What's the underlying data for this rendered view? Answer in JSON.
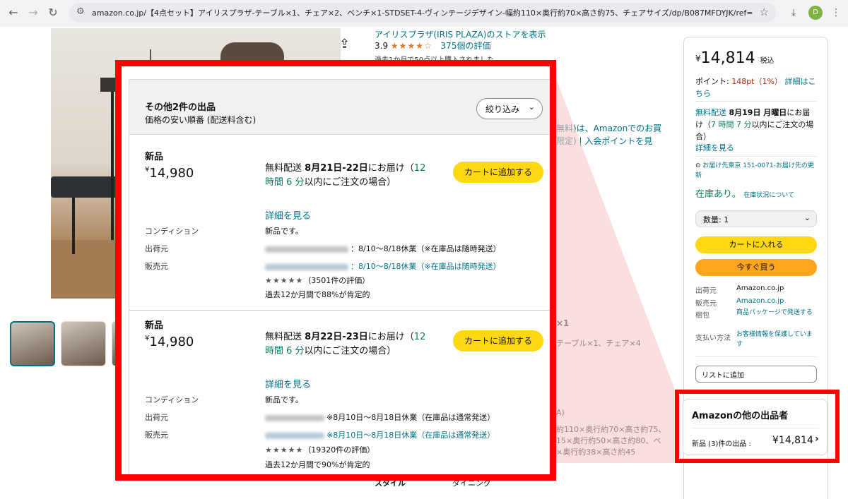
{
  "browser": {
    "url": "amazon.co.jp/【4点セット】アイリスプラザ-テーブル×1、チェア×2、ベンチ×1-STDSET-4-ヴィンテージデザイン-幅約110×奥行約70×高さ約75、チェアサイズ/dp/B087MFDYJK/ref=sr_1_5?__mk_ja_JP=カ...",
    "back_icon": "back-arrow-icon",
    "forward_icon": "forward-arrow-icon",
    "reload_icon": "reload-icon",
    "profile_initial": "D"
  },
  "product": {
    "store_link": "アイリスプラザ(IRIS PLAZA)のストアを表示",
    "rating_value": "3.9",
    "rating_stars": "★★★★☆",
    "rating_count": "375個の評価",
    "purchases": "過去1か月で50点以上購入されました",
    "bg_snippet_1": "無料)は、Amazonでのお買",
    "bg_snippet_2": "限定) | 入会ポイントを見",
    "bg_snippet_3": "×1",
    "bg_snippet_4": "テーブル×1、チェア×4",
    "bg_snippet_5": "A)",
    "bg_snippet_6": "約110×奥行約70×高さ約75、",
    "bg_snippet_7": "15×奥行約50×高さ約80、ベ",
    "bg_snippet_8": "×奥行約38×高さ約45",
    "bottom_left": "スタイル",
    "bottom_right": "ダイニング"
  },
  "buybox": {
    "yen": "¥",
    "price": "14,814",
    "tax": "税込",
    "points_label": "ポイント: ",
    "points_value": "148pt（1%）",
    "points_link": "詳細はこちら",
    "delivery_free": "無料配送",
    "delivery_date": "8月19日 月曜日",
    "delivery_suffix": "にお届け（",
    "delivery_timer": "7 時間 7 分",
    "delivery_tail": "以内にご注文の場合）",
    "delivery_more": "詳細を見る",
    "location_icon": "location-pin-icon",
    "location": "お届け先東京 151-0071-お届け先の更新",
    "stock": "在庫あり。",
    "stock_link": "在庫状況について",
    "qty": "数量: 1",
    "add_cart": "カートに入れる",
    "buy_now": "今すぐ買う",
    "ship_from_k": "出荷元",
    "ship_from_v": "Amazon.co.jp",
    "seller_k": "販売元",
    "seller_v": "Amazon.co.jp",
    "pack_k": "梱包",
    "pack_v": "商品パッケージで発送する",
    "pay_k": "支払い方法",
    "pay_v": "お客様情報を保護しています",
    "wishlist": "リストに追加"
  },
  "other_sellers_box": {
    "title": "Amazonの他の出品者",
    "new_label": "新品 (3)件の出品 :",
    "price": "¥14,814",
    "chevron": "›"
  },
  "panel": {
    "title": "その他2件の出品",
    "subtitle": "価格の安い順番 (配送料含む)",
    "filter_label": "絞り込み",
    "offers": [
      {
        "condition": "新品",
        "yen": "¥",
        "price": "14,980",
        "delivery_free": "無料配送",
        "delivery_date": "8月21日-22日",
        "delivery_suffix": "にお届け（",
        "delivery_timer": "12 時間 6 分",
        "delivery_tail": "以内にご注文の場合）",
        "details": "詳細を見る",
        "add_cart": "カートに追加する",
        "condition_label": "コンディション",
        "condition_value": "新品です。",
        "ship_from_label": "出荷元",
        "ship_from_value": "：8/10～8/18休業（※在庫品は随時発送）",
        "seller_label": "販売元",
        "seller_value": "：8/10～8/18休業（※在庫品は随時発送）",
        "stars": "★★★★★",
        "rating_count": "（3501件の評価）",
        "positive": "過去12か月間で88%が肯定的"
      },
      {
        "condition": "新品",
        "yen": "¥",
        "price": "14,980",
        "delivery_free": "無料配送",
        "delivery_date": "8月22日-23日",
        "delivery_suffix": "にお届け（",
        "delivery_timer": "12 時間 6 分",
        "delivery_tail": "以内にご注文の場合）",
        "details": "詳細を見る",
        "add_cart": "カートに追加する",
        "condition_label": "コンディション",
        "condition_value": "新品です。",
        "ship_from_label": "出荷元",
        "ship_from_value": "※8月10日～8月18日休業（在庫品は通常発送）",
        "seller_label": "販売元",
        "seller_value": "※8月10日～8月18日休業（在庫品は通常発送）",
        "stars": "★★★★★",
        "rating_count": "（19320件の評価）",
        "positive": "過去12か月間で90%が肯定的"
      }
    ]
  },
  "colors": {
    "highlight_frame": "#ff0000",
    "link": "#007185",
    "cart_yellow": "#ffd814",
    "buy_orange": "#ffa41c"
  }
}
